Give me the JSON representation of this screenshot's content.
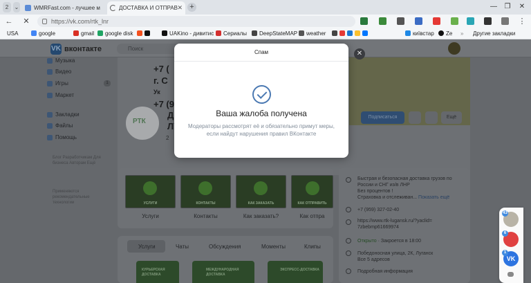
{
  "browser": {
    "tab_count_label": "2",
    "tabs": [
      {
        "title": "WMRFast.com - лучшее м"
      },
      {
        "title": "ДОСТАВКА И ОТПРАВ"
      }
    ],
    "url": "https://vk.com/rtk_lnr",
    "bookmarks": [
      "USA",
      "google",
      "gmail",
      "google disk",
      "UAKino - дивитис",
      "Сериалы",
      "DeepStateMAP",
      "weather",
      "київстар",
      "Ze",
      "Другие закладки"
    ]
  },
  "vk": {
    "logo_text": "вконтакте",
    "search_placeholder": "Поиск",
    "menu": [
      {
        "label": "Музыка"
      },
      {
        "label": "Видео"
      },
      {
        "label": "Игры",
        "badge": "1"
      },
      {
        "label": "Маркет"
      },
      {
        "label": "Закладки"
      },
      {
        "label": "Файлы"
      },
      {
        "label": "Помощь"
      }
    ],
    "footer_links": [
      "Блог",
      "Разработчикам",
      "Для бизнеса",
      "Авторам",
      "Ещё"
    ],
    "footer_note": "Применяются рекомендательные технологии",
    "cover_lines": [
      "+7 (",
      "г. С",
      "Ук",
      "+7 (95"
    ],
    "group_title_part": "До",
    "group_title_part2": "ЛУ",
    "group_logo_text": "РТК",
    "members_hint": "2",
    "subscribe_label": "Подписаться",
    "more_label": "Ещё",
    "services": [
      {
        "caption": "УСЛУГИ",
        "label": "Услуги"
      },
      {
        "caption": "КОНТАКТЫ",
        "label": "Контакты"
      },
      {
        "caption": "КАК ЗАКАЗАТЬ",
        "label": "Как заказать?"
      },
      {
        "caption": "КАК ОТПРАВИТЬ",
        "label": "Как отпра"
      }
    ],
    "page_tabs": [
      "Услуги",
      "Чаты",
      "Обсуждения",
      "Моменты",
      "Клипы"
    ],
    "promos": [
      {
        "text": "КУРЬЕРСКАЯ ДОСТАВКА"
      },
      {
        "text": "МЕЖДУНАРОДНАЯ ДОСТАВКА"
      },
      {
        "text": "ЭКСПРЕСС-ДОСТАВКА"
      }
    ],
    "info": {
      "description": "Быстрая и безопасная доставка грузов по России и СНГ из/в ЛНР",
      "no_fees": "Без процентов !",
      "tracking": "Страховка и отслеживан...",
      "show_more": "Показать ещё",
      "phone": "+7 (959) 327-02-40",
      "link": "https://www.rtk-lugansk.ru/?yaclid=7zbebmp61669974",
      "status_open": "Открыто",
      "closes": "Закроется в 18:00",
      "address": "Победоносная улица, 2К, Луганск",
      "addresses_count": "Все 5 адресов",
      "more_info": "Подробная информация"
    }
  },
  "dialog": {
    "title": "Спам",
    "heading": "Ваша жалоба получена",
    "body": "Модераторы рассмотрят её и обязательно примут меры, если найдут нарушения правил ВКонтакте"
  },
  "side_widget": {
    "badges": [
      "43",
      "6",
      "1"
    ]
  },
  "colors": {
    "vk_blue": "#4b79b2",
    "check": "#4b79b2",
    "overlay_dim": "#65686c"
  }
}
